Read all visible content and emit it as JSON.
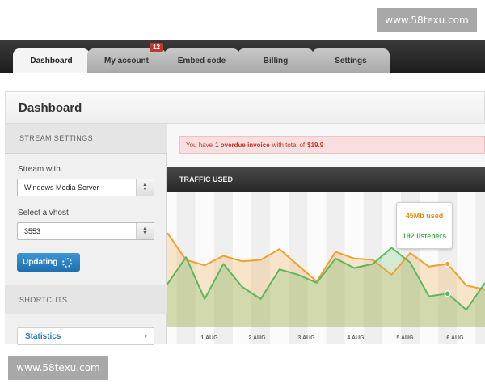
{
  "watermark": {
    "top": "www.58texu.com",
    "bottom": "www.58texu.com"
  },
  "tabs": [
    {
      "label": "Dashboard",
      "active": true
    },
    {
      "label": "My account",
      "badge": "12"
    },
    {
      "label": "Embed code"
    },
    {
      "label": "Billing"
    },
    {
      "label": "Settings"
    }
  ],
  "page_title": "Dashboard",
  "sidebar": {
    "stream_settings_heading": "STREAM SETTINGS",
    "stream_with_label": "Stream with",
    "stream_with_value": "Windows Media Server",
    "vhost_label": "Select a vhost",
    "vhost_value": "3553",
    "updating_label": "Updating",
    "shortcuts_heading": "SHORTCUTS",
    "shortcuts": [
      {
        "label": "Statistics"
      }
    ]
  },
  "alert": {
    "prefix": "You have",
    "highlight": "1 overdue invoice",
    "middle": "with total of",
    "amount": "$19.9"
  },
  "traffic": {
    "heading": "TRAFFIC USED",
    "tooltip_used": "45Mb used",
    "tooltip_listeners": "192 listeners"
  },
  "chart_data": {
    "type": "area",
    "x_labels": [
      "1 AUG",
      "2 AUG",
      "3 AUG",
      "4 AUG",
      "5 AUG",
      "6 AUG"
    ],
    "series": [
      {
        "color": "#f0a030",
        "values": [
          70,
          50,
          46,
          53,
          49,
          50,
          58,
          46,
          34,
          56,
          51,
          50,
          39,
          55,
          45,
          47,
          31,
          28
        ]
      },
      {
        "color": "#5cb85c",
        "values": [
          32,
          52,
          21,
          47,
          30,
          21,
          43,
          39,
          33,
          51,
          44,
          47,
          59,
          48,
          23,
          25,
          13,
          33
        ]
      }
    ],
    "highlight_index": 15,
    "colors": {
      "used": "#f0a030",
      "listeners": "#5cb85c"
    }
  }
}
